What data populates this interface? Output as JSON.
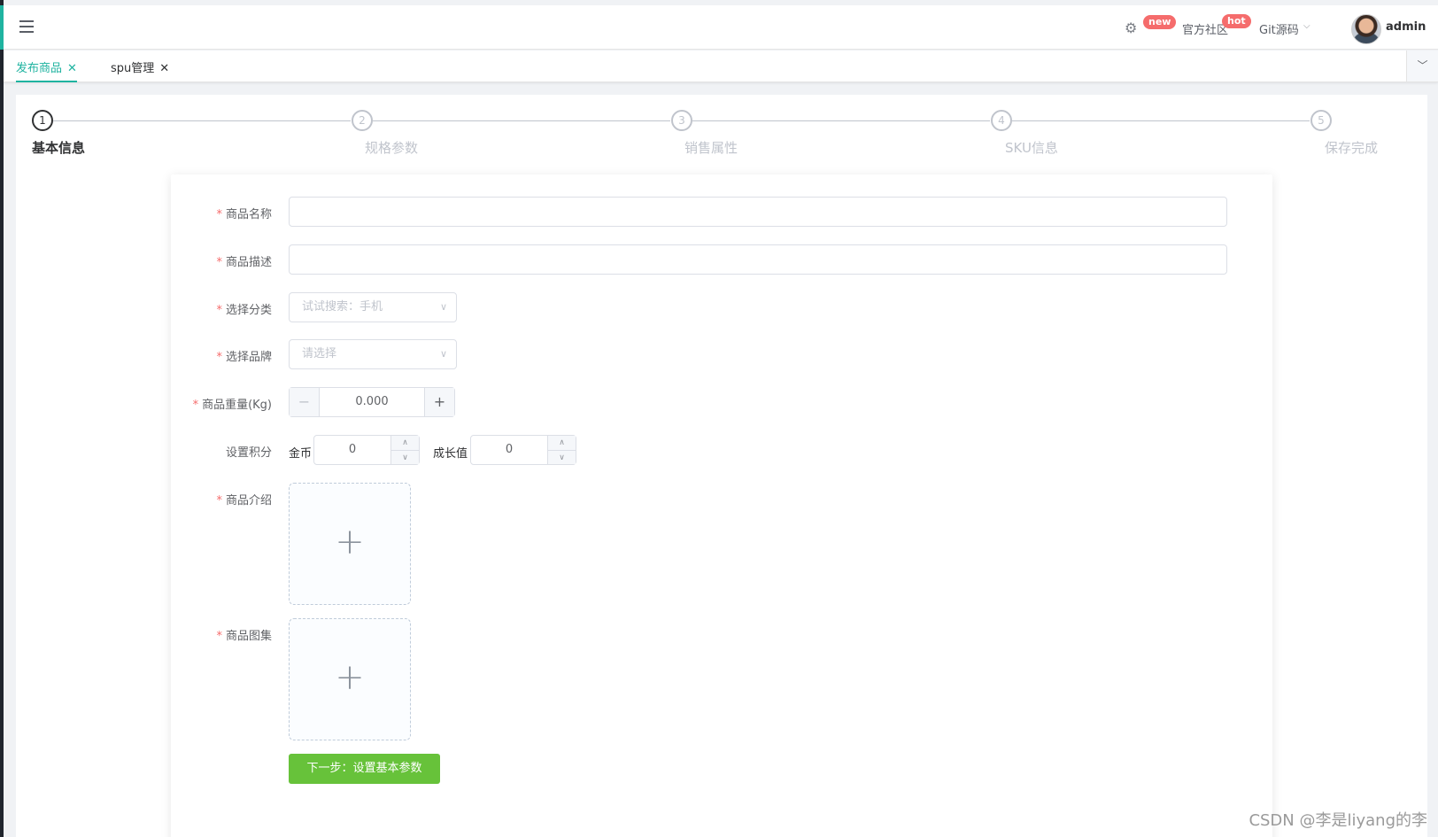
{
  "header": {
    "badge_new": "new",
    "community": "官方社区",
    "badge_hot": "hot",
    "git": "Git源码",
    "username": "admin"
  },
  "tags": [
    {
      "label": "发布商品"
    },
    {
      "label": "spu管理"
    }
  ],
  "steps": [
    {
      "num": "1",
      "title": "基本信息"
    },
    {
      "num": "2",
      "title": "规格参数"
    },
    {
      "num": "3",
      "title": "销售属性"
    },
    {
      "num": "4",
      "title": "SKU信息"
    },
    {
      "num": "5",
      "title": "保存完成"
    }
  ],
  "form": {
    "name_label": "商品名称",
    "desc_label": "商品描述",
    "category_label": "选择分类",
    "category_placeholder": "试试搜索：手机",
    "brand_label": "选择品牌",
    "brand_placeholder": "请选择",
    "weight_label": "商品重量(Kg)",
    "weight_value": "0.000",
    "points_label": "设置积分",
    "gold_label": "金币",
    "gold_value": "0",
    "growth_label": "成长值",
    "growth_value": "0",
    "intro_label": "商品介绍",
    "gallery_label": "商品图集",
    "next_button": "下一步：设置基本参数"
  },
  "watermark": "CSDN @李是liyang的李",
  "colors": {
    "primary": "#1fb3a0",
    "success": "#67c23a",
    "danger": "#f56c6c"
  }
}
